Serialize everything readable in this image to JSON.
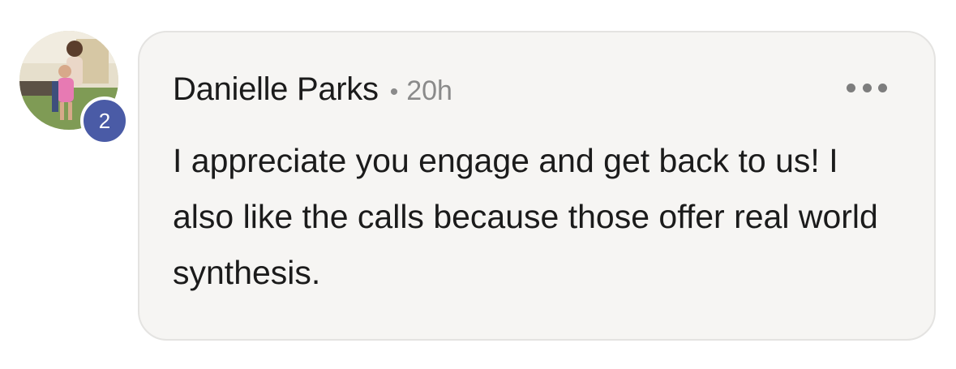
{
  "comment": {
    "avatar": {
      "badge_count": "2",
      "badge_color": "#4a5ba6"
    },
    "author_name": "Danielle Parks",
    "separator": "•",
    "timestamp": "20h",
    "more_icon": "more-horizontal-icon",
    "text": "I appreciate you engage and get back to us! I also like the calls because those offer real world synthesis."
  },
  "colors": {
    "bubble_background": "#f6f5f3",
    "bubble_border": "#e4e3e1",
    "text": "#1b1b1b",
    "meta_text": "#8a8a8a"
  }
}
